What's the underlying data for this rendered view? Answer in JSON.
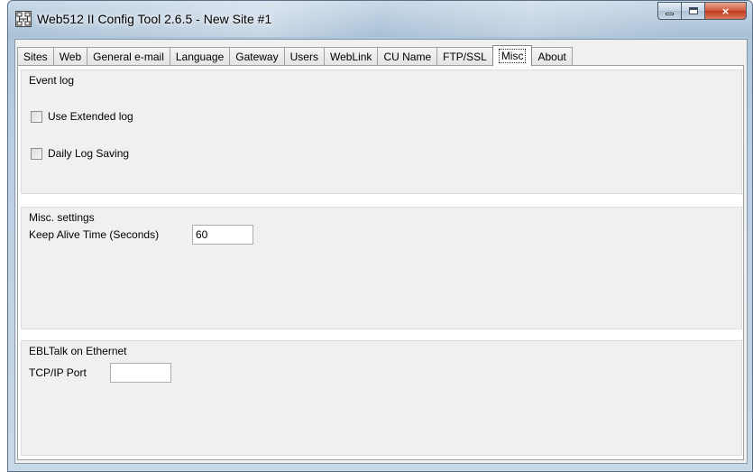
{
  "window": {
    "title": "Web512 II Config Tool 2.6.5 - New Site #1",
    "icon": "app-network-icon",
    "controls": {
      "minimize": "minimize-icon",
      "maximize": "maximize-icon",
      "close": "×"
    }
  },
  "tabs": [
    {
      "label": "Sites",
      "active": false
    },
    {
      "label": "Web",
      "active": false
    },
    {
      "label": "General e-mail",
      "active": false
    },
    {
      "label": "Language",
      "active": false
    },
    {
      "label": "Gateway",
      "active": false
    },
    {
      "label": "Users",
      "active": false
    },
    {
      "label": "WebLink",
      "active": false
    },
    {
      "label": "CU Name",
      "active": false
    },
    {
      "label": "FTP/SSL",
      "active": false
    },
    {
      "label": "Misc",
      "active": true
    },
    {
      "label": "About",
      "active": false
    }
  ],
  "event_log": {
    "title": "Event log",
    "use_extended_log": {
      "label": "Use Extended log",
      "checked": false
    },
    "daily_log_saving": {
      "label": "Daily Log Saving",
      "checked": false
    }
  },
  "misc_settings": {
    "title": "Misc. settings",
    "keep_alive_label": "Keep Alive Time (Seconds)",
    "keep_alive_value": "60"
  },
  "ebltalk": {
    "title": "EBLTalk on Ethernet",
    "tcp_port_label": "TCP/IP Port",
    "tcp_port_value": ""
  }
}
